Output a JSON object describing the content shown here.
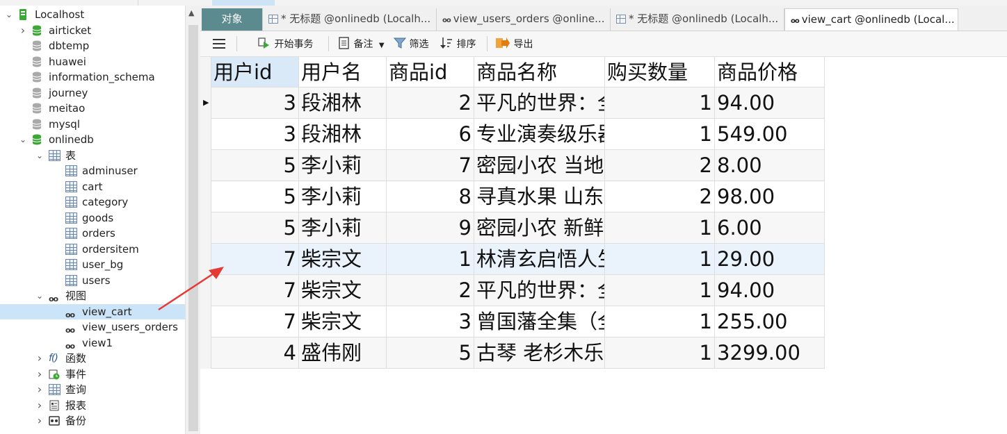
{
  "sidebar": {
    "items": [
      {
        "label": "Localhost",
        "icon": "server-icon",
        "depth": 0,
        "expanded": true
      },
      {
        "label": "airticket",
        "icon": "database-green-icon",
        "depth": 1,
        "expanded": false
      },
      {
        "label": "dbtemp",
        "icon": "database-gray-icon",
        "depth": 1
      },
      {
        "label": "huawei",
        "icon": "database-gray-icon",
        "depth": 1
      },
      {
        "label": "information_schema",
        "icon": "database-gray-icon",
        "depth": 1
      },
      {
        "label": "journey",
        "icon": "database-gray-icon",
        "depth": 1
      },
      {
        "label": "meitao",
        "icon": "database-gray-icon",
        "depth": 1
      },
      {
        "label": "mysql",
        "icon": "database-gray-icon",
        "depth": 1
      },
      {
        "label": "onlinedb",
        "icon": "database-green-icon",
        "depth": 1,
        "expanded": true
      },
      {
        "label": "表",
        "icon": "tables-folder-icon",
        "depth": 2,
        "expanded": true
      },
      {
        "label": "adminuser",
        "icon": "table-icon",
        "depth": 3
      },
      {
        "label": "cart",
        "icon": "table-icon",
        "depth": 3
      },
      {
        "label": "category",
        "icon": "table-icon",
        "depth": 3
      },
      {
        "label": "goods",
        "icon": "table-icon",
        "depth": 3
      },
      {
        "label": "orders",
        "icon": "table-icon",
        "depth": 3
      },
      {
        "label": "ordersitem",
        "icon": "table-icon",
        "depth": 3
      },
      {
        "label": "user_bg",
        "icon": "table-icon",
        "depth": 3
      },
      {
        "label": "users",
        "icon": "table-icon",
        "depth": 3
      },
      {
        "label": "视图",
        "icon": "views-folder-icon",
        "depth": 2,
        "expanded": true
      },
      {
        "label": "view_cart",
        "icon": "view-icon",
        "depth": 3,
        "selected": true
      },
      {
        "label": "view_users_orders",
        "icon": "view-icon",
        "depth": 3
      },
      {
        "label": "view1",
        "icon": "view-icon",
        "depth": 3
      },
      {
        "label": "函数",
        "icon": "function-icon",
        "depth": 2,
        "expanded": false
      },
      {
        "label": "事件",
        "icon": "event-icon",
        "depth": 2,
        "expanded": false
      },
      {
        "label": "查询",
        "icon": "query-icon",
        "depth": 2,
        "expanded": false
      },
      {
        "label": "报表",
        "icon": "report-icon",
        "depth": 2,
        "expanded": false
      },
      {
        "label": "备份",
        "icon": "backup-icon",
        "depth": 2,
        "expanded": false
      }
    ]
  },
  "tabs": [
    {
      "label": "对象",
      "kind": "objects"
    },
    {
      "label": "* 无标题 @onlinedb (Localh...",
      "kind": "query"
    },
    {
      "label": "view_users_orders @online...",
      "kind": "view"
    },
    {
      "label": "* 无标题 @onlinedb (Localh...",
      "kind": "query"
    },
    {
      "label": "view_cart @onlinedb (Local...",
      "kind": "view",
      "active": true
    }
  ],
  "toolbar": {
    "begin_transaction": "开始事务",
    "note": "备注",
    "filter": "筛选",
    "sort": "排序",
    "export": "导出"
  },
  "grid": {
    "columns": [
      "用户id",
      "用户名",
      "商品id",
      "商品名称",
      "购买数量",
      "商品价格"
    ],
    "rows": [
      [
        "3",
        "段湘林",
        "2",
        "平凡的世界：全",
        "1",
        "94.00"
      ],
      [
        "3",
        "段湘林",
        "6",
        "专业演奏级乐器",
        "1",
        "549.00"
      ],
      [
        "5",
        "李小莉",
        "7",
        "密园小农 当地",
        "2",
        "8.00"
      ],
      [
        "5",
        "李小莉",
        "8",
        "寻真水果 山东",
        "2",
        "98.00"
      ],
      [
        "5",
        "李小莉",
        "9",
        "密园小农 新鲜",
        "1",
        "6.00"
      ],
      [
        "7",
        "柴宗文",
        "1",
        "林清玄启悟人生",
        "1",
        "29.00"
      ],
      [
        "7",
        "柴宗文",
        "2",
        "平凡的世界：全",
        "1",
        "94.00"
      ],
      [
        "7",
        "柴宗文",
        "3",
        "曾国藩全集（全",
        "1",
        "255.00"
      ],
      [
        "4",
        "盛伟刚",
        "5",
        "古琴 老杉木乐",
        "1",
        "3299.00"
      ]
    ],
    "current_row": 0,
    "highlighted_row": 5
  },
  "colors": {
    "objects_tab": "#5b8a8f",
    "selected_tree_row": "#cce4f7",
    "annotation_arrow": "#e53935",
    "db_active": "#3aa935"
  }
}
